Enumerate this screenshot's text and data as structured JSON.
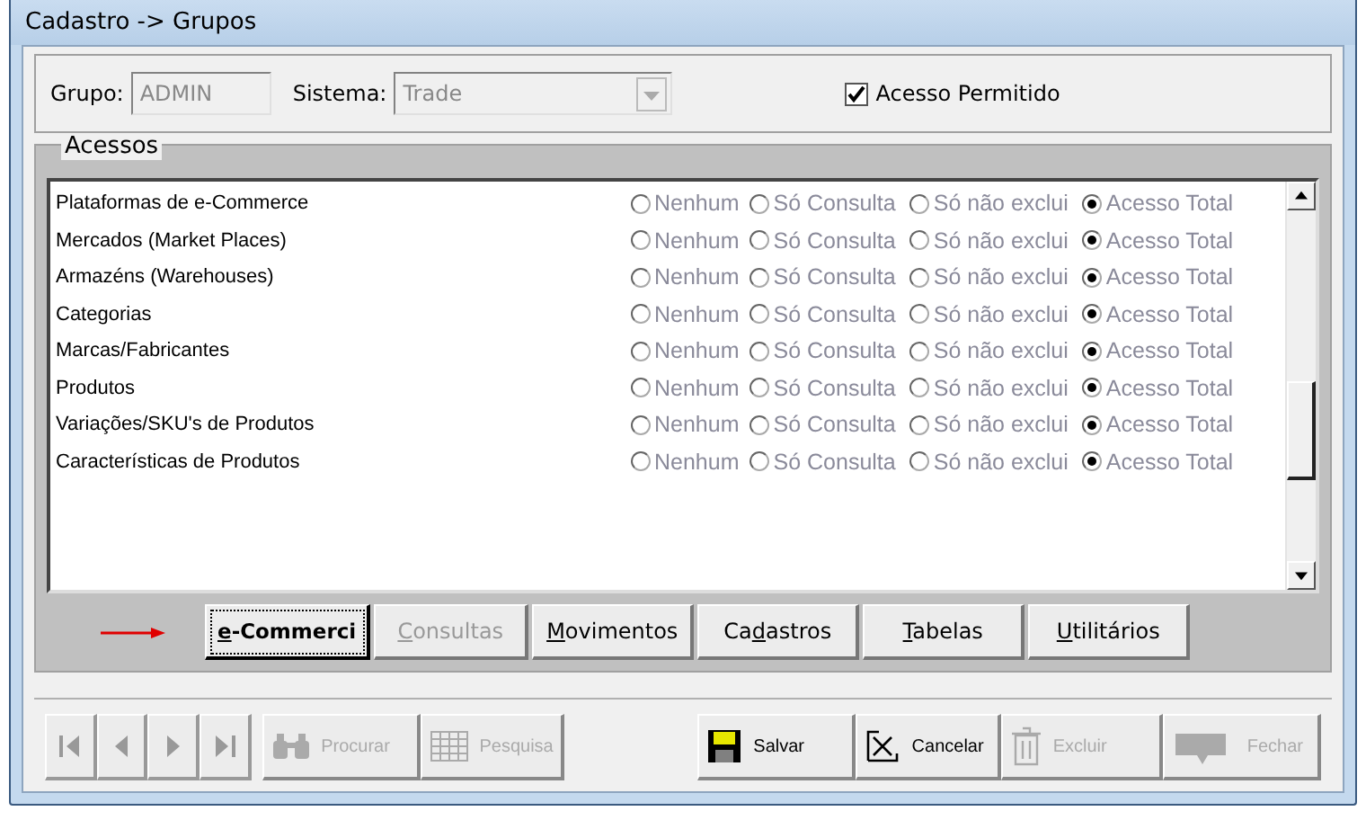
{
  "window": {
    "title": "Cadastro -> Grupos"
  },
  "header": {
    "group_label": "Grupo:",
    "group_value": "ADMIN",
    "system_label": "Sistema:",
    "system_value": "Trade",
    "access_allowed": {
      "label": "Acesso Permitido",
      "checked": true
    }
  },
  "access_panel": {
    "title": "Acessos",
    "rows": [
      {
        "name": "Plataformas de e-Commerce",
        "options": [
          {
            "label": "Nenhum",
            "selected": false
          },
          {
            "label": "Só Consulta",
            "selected": false
          },
          {
            "label": "Só não exclui",
            "selected": false
          },
          {
            "label": "Acesso Total",
            "selected": true
          }
        ]
      },
      {
        "name": "Mercados (Market Places)",
        "options": [
          {
            "label": "Nenhum",
            "selected": false
          },
          {
            "label": "Só Consulta",
            "selected": false
          },
          {
            "label": "Só não exclui",
            "selected": false
          },
          {
            "label": "Acesso Total",
            "selected": true
          }
        ]
      },
      {
        "name": "Armazéns (Warehouses)",
        "options": [
          {
            "label": "Nenhum",
            "selected": false
          },
          {
            "label": "Só Consulta",
            "selected": false
          },
          {
            "label": "Só não exclui",
            "selected": false
          },
          {
            "label": "Acesso Total",
            "selected": true
          }
        ]
      },
      {
        "name": "Categorias",
        "options": [
          {
            "label": "Nenhum",
            "selected": false
          },
          {
            "label": "Só Consulta",
            "selected": false
          },
          {
            "label": "Só não exclui",
            "selected": false
          },
          {
            "label": "Acesso Total",
            "selected": true
          }
        ]
      },
      {
        "name": "Marcas/Fabricantes",
        "options": [
          {
            "label": "Nenhum",
            "selected": false
          },
          {
            "label": "Só Consulta",
            "selected": false
          },
          {
            "label": "Só não exclui",
            "selected": false
          },
          {
            "label": "Acesso Total",
            "selected": true
          }
        ]
      },
      {
        "name": "Produtos",
        "options": [
          {
            "label": "Nenhum",
            "selected": false
          },
          {
            "label": "Só Consulta",
            "selected": false
          },
          {
            "label": "Só não exclui",
            "selected": false
          },
          {
            "label": "Acesso Total",
            "selected": true
          }
        ]
      },
      {
        "name": "Variações/SKU's de Produtos",
        "options": [
          {
            "label": "Nenhum",
            "selected": false
          },
          {
            "label": "Só Consulta",
            "selected": false
          },
          {
            "label": "Só não exclui",
            "selected": false
          },
          {
            "label": "Acesso Total",
            "selected": true
          }
        ]
      },
      {
        "name": "Características de Produtos",
        "options": [
          {
            "label": "Nenhum",
            "selected": false
          },
          {
            "label": "Só Consulta",
            "selected": false
          },
          {
            "label": "Só não exclui",
            "selected": false
          },
          {
            "label": "Acesso Total",
            "selected": true
          }
        ]
      }
    ],
    "tabs": [
      {
        "key": "e",
        "after": "-Commerci",
        "selected": true,
        "disabled": false
      },
      {
        "key": "C",
        "after": "onsultas",
        "selected": false,
        "disabled": true
      },
      {
        "key": "M",
        "after": "ovimentos",
        "selected": false,
        "disabled": false
      },
      {
        "before": "Ca",
        "key": "d",
        "after": "astros",
        "selected": false,
        "disabled": false
      },
      {
        "key": "T",
        "after": "abelas",
        "selected": false,
        "disabled": false
      },
      {
        "key": "U",
        "after": "tilitários",
        "selected": false,
        "disabled": false
      }
    ]
  },
  "toolbar": {
    "navigation": [
      {
        "kind": "first",
        "disabled": true
      },
      {
        "kind": "prev",
        "disabled": true
      },
      {
        "kind": "next",
        "disabled": true
      },
      {
        "kind": "last",
        "disabled": true
      }
    ],
    "buttons": [
      {
        "kind": "search",
        "label": "Procurar",
        "disabled": true
      },
      {
        "kind": "grid",
        "label": "Pesquisa",
        "disabled": true
      },
      {
        "kind": "save",
        "label": "Salvar",
        "disabled": false
      },
      {
        "kind": "cancel",
        "label": "Cancelar",
        "disabled": false
      },
      {
        "kind": "delete",
        "label": "Excluir",
        "disabled": true
      },
      {
        "kind": "close",
        "label": "Fechar",
        "disabled": true
      }
    ]
  }
}
